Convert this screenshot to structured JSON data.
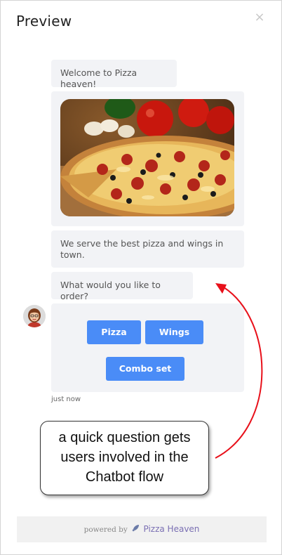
{
  "header": {
    "title": "Preview",
    "close_icon": "×"
  },
  "chat": {
    "messages": [
      "Welcome to Pizza heaven!",
      "We serve the best pizza and wings in town.",
      "What would you like to order?"
    ],
    "image_description": "pizza-photo",
    "quick_replies": [
      "Pizza",
      "Wings",
      "Combo set"
    ],
    "timestamp": "just now",
    "avatar": "agent-avatar"
  },
  "annotation": {
    "text": "a quick question gets users involved in the Chatbot flow"
  },
  "footer": {
    "powered_by": "powered by",
    "brand": "Pizza Heaven"
  },
  "colors": {
    "accent": "#4a8cf7",
    "bubble": "#f2f3f6",
    "arrow": "#e8101a",
    "brand": "#7a6fb3"
  }
}
